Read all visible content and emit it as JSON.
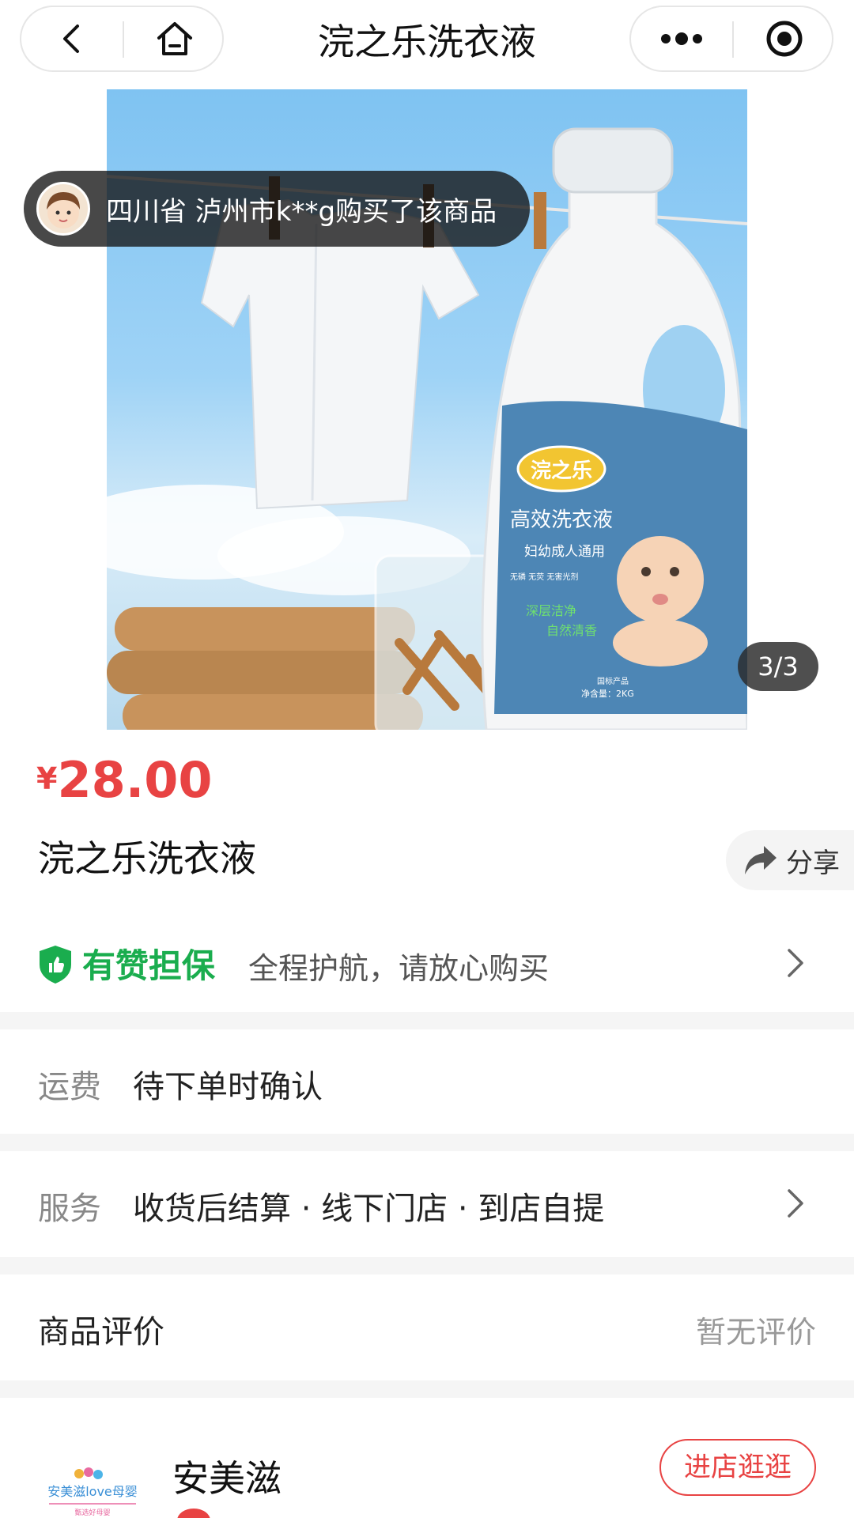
{
  "nav": {
    "title": "浣之乐洗衣液",
    "icons": [
      "back-icon",
      "home-icon",
      "more-icon",
      "target-icon"
    ]
  },
  "hero": {
    "buyer_notice": "四川省 泸州市k**g购买了该商品",
    "image_counter": "3/3",
    "product_image": {
      "brand": "浣之乐",
      "subtitle": "高效洗衣液",
      "tagline": "妇幼成人通用",
      "badges": "无磷  无荧  无害光剂",
      "features": [
        "深层洁净",
        "自然清香"
      ],
      "spec_label": "国标产品",
      "net_weight": "净含量：2KG"
    }
  },
  "product": {
    "currency": "¥",
    "price": "28.00",
    "title": "浣之乐洗衣液",
    "share_label": "分享"
  },
  "guarantee": {
    "title": "有赞担保",
    "description": "全程护航，请放心购买"
  },
  "shipping": {
    "label": "运费",
    "value": "待下单时确认"
  },
  "service": {
    "label": "服务",
    "value": "收货后结算 · 线下门店 · 到店自提"
  },
  "reviews": {
    "title": "商品评价",
    "value": "暂无评价"
  },
  "store": {
    "logo_text": "安美滋love母婴",
    "logo_subtext": "甄选好母婴",
    "name": "安美滋",
    "visit_label": "进店逛逛"
  },
  "colors": {
    "price": "#e84343",
    "guarantee_green": "#1aad4e",
    "section_gap": "#f5f5f5"
  }
}
